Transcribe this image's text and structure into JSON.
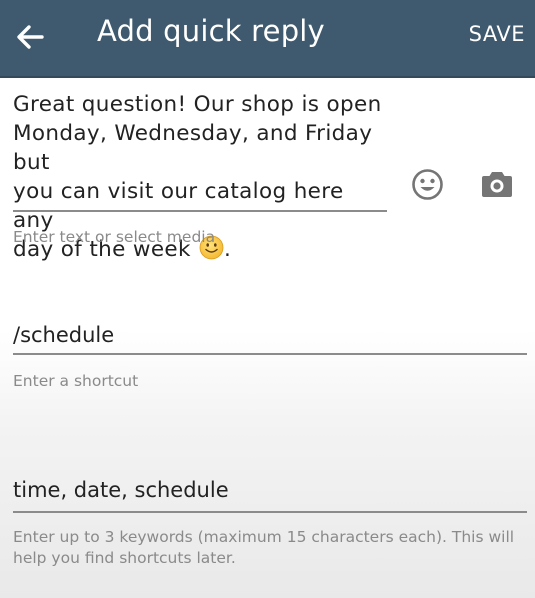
{
  "header": {
    "title": "Add quick reply",
    "save_label": "SAVE",
    "back_icon": "arrow-left-icon",
    "background_color": "#3f5a6e"
  },
  "message": {
    "text": "Great question! Our shop is open\nMonday, Wednesday, and Friday but\nyou can visit our catalog here any\nday of the week ",
    "end_punctuation": ".",
    "inline_emoji": "slightly-smiling-face",
    "hint": "Enter text or select media",
    "emoji_button_icon": "smiley-icon",
    "camera_button_icon": "camera-icon"
  },
  "shortcut": {
    "value": "/schedule",
    "hint": "Enter a shortcut"
  },
  "keywords": {
    "value": "time, date, schedule",
    "hint": "Enter up to 3 keywords (maximum 15 characters each). This will help you find shortcuts later."
  }
}
